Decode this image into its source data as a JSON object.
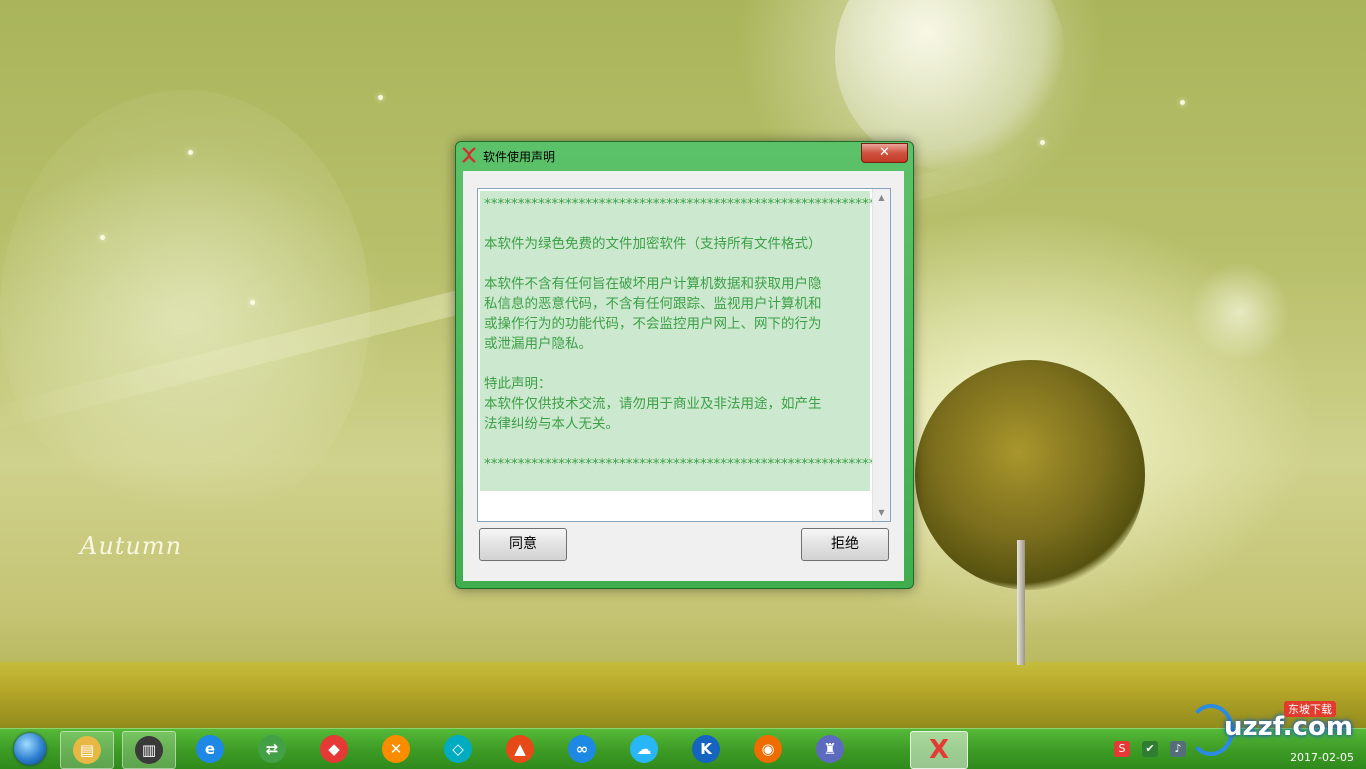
{
  "desktop": {
    "wallpaper_text": "Autumn"
  },
  "dialog": {
    "title": "软件使用声明",
    "close_label": "✕",
    "notice_lines": [
      "***********************************************************",
      "",
      "本软件为绿色免费的文件加密软件（支持所有文件格式）",
      "",
      "本软件不含有任何旨在破坏用户计算机数据和获取用户隐",
      "私信息的恶意代码，不含有任何跟踪、监视用户计算机和",
      "或操作行为的功能代码，不会监控用户网上、网下的行为",
      "或泄漏用户隐私。",
      "",
      "特此声明：",
      "本软件仅供技术交流，请勿用于商业及非法用途，如产生",
      "法律纠纷与本人无关。",
      "",
      "***********************************************************"
    ],
    "agree_label": "同意",
    "refuse_label": "拒绝"
  },
  "taskbar": {
    "pinned_apps": [
      {
        "name": "file-explorer",
        "glyph": "▤",
        "color": "#e8b845"
      },
      {
        "name": "system-monitor",
        "glyph": "▥",
        "color": "#3a3a3a"
      },
      {
        "name": "internet-explorer",
        "glyph": "e",
        "color": "#1e88e5"
      },
      {
        "name": "app-green",
        "glyph": "⇄",
        "color": "#43a047"
      },
      {
        "name": "app-colorful",
        "glyph": "◆",
        "color": "#e53935"
      },
      {
        "name": "app-multicolor",
        "glyph": "✕",
        "color": "#fb8c00"
      },
      {
        "name": "app-teal",
        "glyph": "◇",
        "color": "#00acc1"
      },
      {
        "name": "app-red",
        "glyph": "▲",
        "color": "#e64a19"
      },
      {
        "name": "baidu-netdisk",
        "glyph": "∞",
        "color": "#1e88e5"
      },
      {
        "name": "cloud-app",
        "glyph": "☁",
        "color": "#29b6f6"
      },
      {
        "name": "kugou",
        "glyph": "K",
        "color": "#1565c0"
      },
      {
        "name": "firefox",
        "glyph": "◉",
        "color": "#ef6c00"
      },
      {
        "name": "castle-app",
        "glyph": "♜",
        "color": "#5c6bc0"
      }
    ],
    "active_app": {
      "name": "encrypt-tool",
      "glyph": "Ⅹ",
      "color": "#e53935"
    },
    "tray_icons": [
      {
        "name": "sogou-input-icon",
        "glyph": "S",
        "color": "#e53935"
      },
      {
        "name": "shield-icon",
        "glyph": "✔",
        "color": "#2e7d32"
      },
      {
        "name": "volume-icon",
        "glyph": "♪",
        "color": "#546e7a"
      }
    ],
    "clock_date": "2017-02-05"
  },
  "watermark": {
    "text": "uzzf.com",
    "badge": "东坡下载"
  }
}
